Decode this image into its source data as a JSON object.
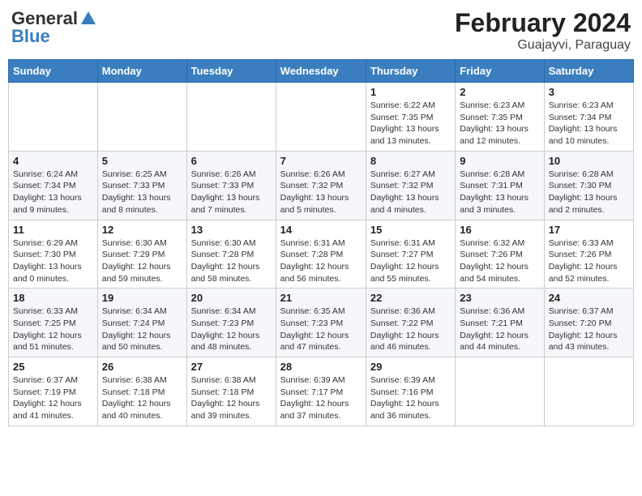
{
  "header": {
    "logo_general": "General",
    "logo_blue": "Blue",
    "title": "February 2024",
    "location": "Guajayvi, Paraguay"
  },
  "weekdays": [
    "Sunday",
    "Monday",
    "Tuesday",
    "Wednesday",
    "Thursday",
    "Friday",
    "Saturday"
  ],
  "weeks": [
    [
      {
        "day": "",
        "info": ""
      },
      {
        "day": "",
        "info": ""
      },
      {
        "day": "",
        "info": ""
      },
      {
        "day": "",
        "info": ""
      },
      {
        "day": "1",
        "info": "Sunrise: 6:22 AM\nSunset: 7:35 PM\nDaylight: 13 hours and 13 minutes."
      },
      {
        "day": "2",
        "info": "Sunrise: 6:23 AM\nSunset: 7:35 PM\nDaylight: 13 hours and 12 minutes."
      },
      {
        "day": "3",
        "info": "Sunrise: 6:23 AM\nSunset: 7:34 PM\nDaylight: 13 hours and 10 minutes."
      }
    ],
    [
      {
        "day": "4",
        "info": "Sunrise: 6:24 AM\nSunset: 7:34 PM\nDaylight: 13 hours and 9 minutes."
      },
      {
        "day": "5",
        "info": "Sunrise: 6:25 AM\nSunset: 7:33 PM\nDaylight: 13 hours and 8 minutes."
      },
      {
        "day": "6",
        "info": "Sunrise: 6:26 AM\nSunset: 7:33 PM\nDaylight: 13 hours and 7 minutes."
      },
      {
        "day": "7",
        "info": "Sunrise: 6:26 AM\nSunset: 7:32 PM\nDaylight: 13 hours and 5 minutes."
      },
      {
        "day": "8",
        "info": "Sunrise: 6:27 AM\nSunset: 7:32 PM\nDaylight: 13 hours and 4 minutes."
      },
      {
        "day": "9",
        "info": "Sunrise: 6:28 AM\nSunset: 7:31 PM\nDaylight: 13 hours and 3 minutes."
      },
      {
        "day": "10",
        "info": "Sunrise: 6:28 AM\nSunset: 7:30 PM\nDaylight: 13 hours and 2 minutes."
      }
    ],
    [
      {
        "day": "11",
        "info": "Sunrise: 6:29 AM\nSunset: 7:30 PM\nDaylight: 13 hours and 0 minutes."
      },
      {
        "day": "12",
        "info": "Sunrise: 6:30 AM\nSunset: 7:29 PM\nDaylight: 12 hours and 59 minutes."
      },
      {
        "day": "13",
        "info": "Sunrise: 6:30 AM\nSunset: 7:28 PM\nDaylight: 12 hours and 58 minutes."
      },
      {
        "day": "14",
        "info": "Sunrise: 6:31 AM\nSunset: 7:28 PM\nDaylight: 12 hours and 56 minutes."
      },
      {
        "day": "15",
        "info": "Sunrise: 6:31 AM\nSunset: 7:27 PM\nDaylight: 12 hours and 55 minutes."
      },
      {
        "day": "16",
        "info": "Sunrise: 6:32 AM\nSunset: 7:26 PM\nDaylight: 12 hours and 54 minutes."
      },
      {
        "day": "17",
        "info": "Sunrise: 6:33 AM\nSunset: 7:26 PM\nDaylight: 12 hours and 52 minutes."
      }
    ],
    [
      {
        "day": "18",
        "info": "Sunrise: 6:33 AM\nSunset: 7:25 PM\nDaylight: 12 hours and 51 minutes."
      },
      {
        "day": "19",
        "info": "Sunrise: 6:34 AM\nSunset: 7:24 PM\nDaylight: 12 hours and 50 minutes."
      },
      {
        "day": "20",
        "info": "Sunrise: 6:34 AM\nSunset: 7:23 PM\nDaylight: 12 hours and 48 minutes."
      },
      {
        "day": "21",
        "info": "Sunrise: 6:35 AM\nSunset: 7:23 PM\nDaylight: 12 hours and 47 minutes."
      },
      {
        "day": "22",
        "info": "Sunrise: 6:36 AM\nSunset: 7:22 PM\nDaylight: 12 hours and 46 minutes."
      },
      {
        "day": "23",
        "info": "Sunrise: 6:36 AM\nSunset: 7:21 PM\nDaylight: 12 hours and 44 minutes."
      },
      {
        "day": "24",
        "info": "Sunrise: 6:37 AM\nSunset: 7:20 PM\nDaylight: 12 hours and 43 minutes."
      }
    ],
    [
      {
        "day": "25",
        "info": "Sunrise: 6:37 AM\nSunset: 7:19 PM\nDaylight: 12 hours and 41 minutes."
      },
      {
        "day": "26",
        "info": "Sunrise: 6:38 AM\nSunset: 7:18 PM\nDaylight: 12 hours and 40 minutes."
      },
      {
        "day": "27",
        "info": "Sunrise: 6:38 AM\nSunset: 7:18 PM\nDaylight: 12 hours and 39 minutes."
      },
      {
        "day": "28",
        "info": "Sunrise: 6:39 AM\nSunset: 7:17 PM\nDaylight: 12 hours and 37 minutes."
      },
      {
        "day": "29",
        "info": "Sunrise: 6:39 AM\nSunset: 7:16 PM\nDaylight: 12 hours and 36 minutes."
      },
      {
        "day": "",
        "info": ""
      },
      {
        "day": "",
        "info": ""
      }
    ]
  ]
}
